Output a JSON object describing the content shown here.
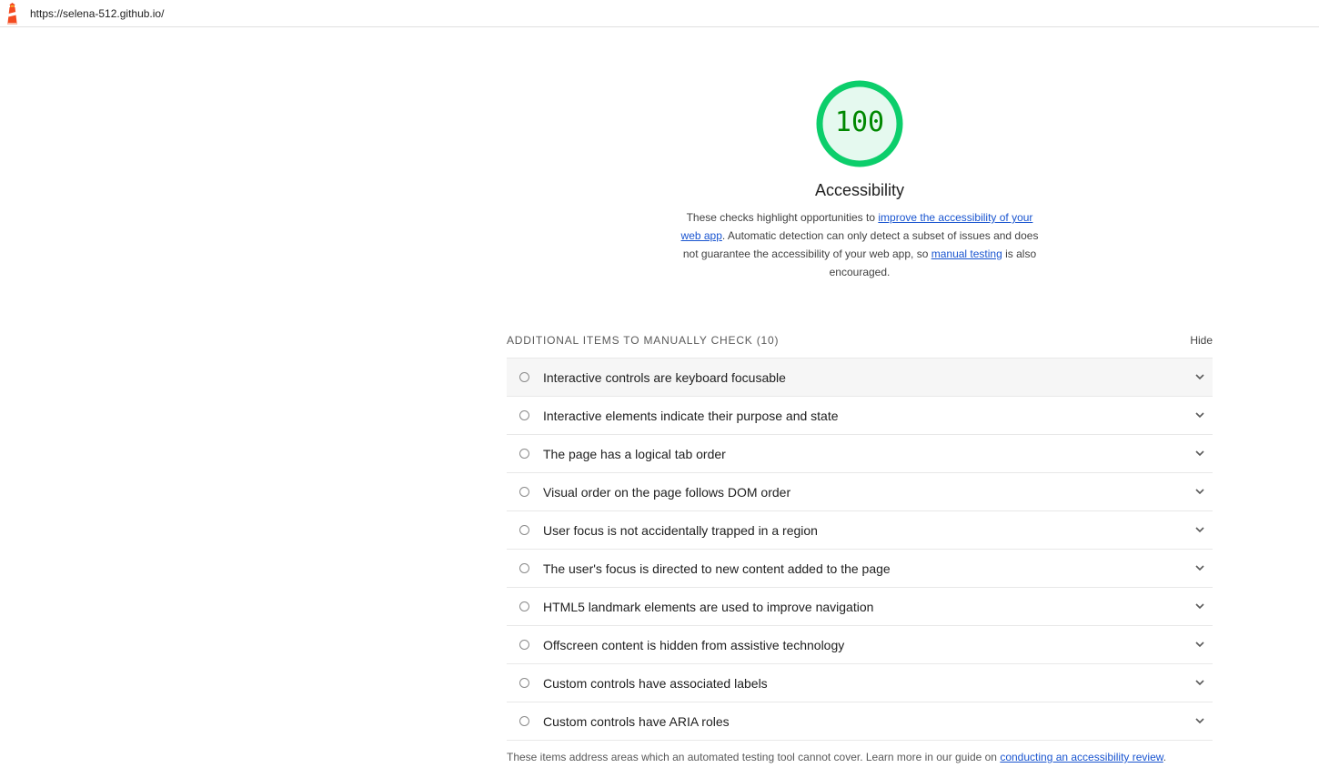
{
  "header": {
    "url": "https://selena-512.github.io/"
  },
  "category": {
    "score": "100",
    "title": "Accessibility",
    "description": {
      "part1": "These checks highlight opportunities to ",
      "link1": "improve the accessibility of your web app",
      "part2": ". Automatic detection can only detect a subset of issues and does not guarantee the accessibility of your web app, so ",
      "link2": "manual testing",
      "part3": " is also encouraged."
    },
    "colors": {
      "gauge_ring": "#0cce6b",
      "gauge_fill": "#e5f9ef",
      "score_text": "#008800"
    }
  },
  "group": {
    "title": "ADDITIONAL ITEMS TO MANUALLY CHECK",
    "count": "(10)",
    "toggle_label": "Hide",
    "audits": [
      "Interactive controls are keyboard focusable",
      "Interactive elements indicate their purpose and state",
      "The page has a logical tab order",
      "Visual order on the page follows DOM order",
      "User focus is not accidentally trapped in a region",
      "The user's focus is directed to new content added to the page",
      "HTML5 landmark elements are used to improve navigation",
      "Offscreen content is hidden from assistive technology",
      "Custom controls have associated labels",
      "Custom controls have ARIA roles"
    ],
    "footnote": {
      "text": "These items address areas which an automated testing tool cannot cover. Learn more in our guide on ",
      "link": "conducting an accessibility review",
      "end": "."
    }
  },
  "icons": {
    "logo": "lighthouse-logo-icon",
    "audit_status": "manual-check-circle-icon",
    "expand": "chevron-down-icon"
  }
}
